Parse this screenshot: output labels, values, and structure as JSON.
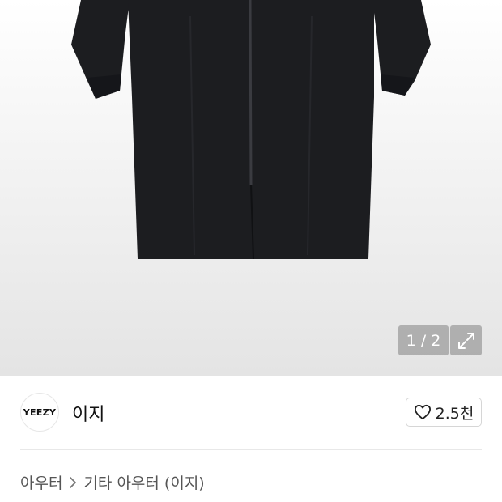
{
  "gallery": {
    "counter": "1 / 2",
    "expand_icon": "expand-arrows-icon",
    "image_subject": "black long hooded zip-up coat"
  },
  "brand": {
    "logo_text": "YEEZY",
    "name": "이지"
  },
  "like": {
    "icon": "heart-outline-icon",
    "count": "2.5천"
  },
  "breadcrumb": {
    "items": [
      "아우터",
      "기타 아우터 (이지)"
    ],
    "separator_icon": "chevron-right-icon"
  },
  "colors": {
    "coat": "#1c1d20",
    "gallery_bg_bottom": "#e4e4e4",
    "badge_bg": "#9a9a9a",
    "divider": "#e8e8e8"
  }
}
